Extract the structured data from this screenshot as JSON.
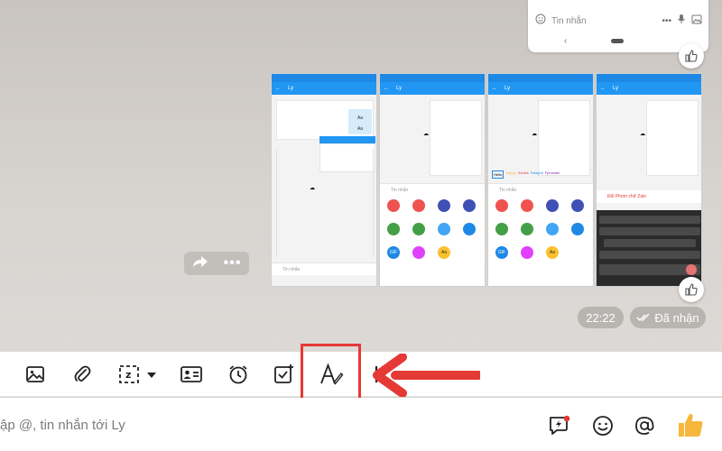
{
  "previous_message": {
    "input_placeholder": "Tin nhắn",
    "more_label": "•••"
  },
  "phones": {
    "contact_name": "Ly",
    "input_placeholder": "Tin nhắn",
    "chip_aa": "Aa",
    "gif_label": "GIF",
    "font_styles": [
      "Hello",
      "Happy",
      "Xchiek",
      "Fshightl",
      "Fpmnsfei"
    ],
    "sample_text": "Đổi Phom chữ Zalo"
  },
  "chat": {
    "forward_more": "•••",
    "time": "22:22",
    "status": "Đã nhận"
  },
  "toolbar": {
    "more_label": "•••",
    "items": [
      "image-icon",
      "paperclip-icon",
      "screenshot-icon",
      "contact-card-icon",
      "alarm-icon",
      "checklist-icon",
      "font-style-icon",
      "cursor-icon",
      "more-icon"
    ]
  },
  "composer": {
    "placeholder": "ập @, tin nhắn tới Ly"
  },
  "colors": {
    "accent_blue": "#2196f3",
    "highlight_red": "#e53935",
    "thumb_yellow": "#f6b73c"
  }
}
